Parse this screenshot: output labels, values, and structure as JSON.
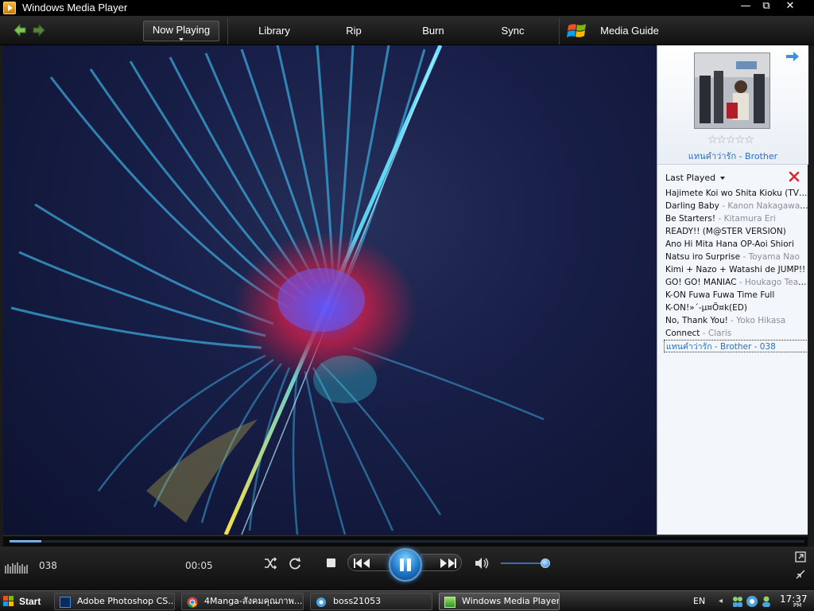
{
  "window": {
    "title": "Windows Media Player",
    "controls": {
      "minimize": "—",
      "maximize": "⧉",
      "close": "✕"
    }
  },
  "nav": {
    "tabs": [
      {
        "label": "Now Playing",
        "active": true
      },
      {
        "label": "Library"
      },
      {
        "label": "Rip"
      },
      {
        "label": "Burn"
      },
      {
        "label": "Sync"
      },
      {
        "label": "Media Guide"
      }
    ]
  },
  "now_playing": {
    "title_artist": "แทนคำว่ารัก - Brother",
    "rating_stars": "☆☆☆☆☆",
    "rating_value": 0
  },
  "playlist": {
    "header": "Last Played",
    "items": [
      {
        "title": "Hajimete Koi wo Shita Kioku (TV Edit)",
        "artist": ""
      },
      {
        "title": "Darling Baby",
        "artist": " - Kanon Nakagawa starring Nao Toyama"
      },
      {
        "title": "Be Starters!",
        "artist": " - Kitamura Eri"
      },
      {
        "title": "READY!! (M@STER VERSION)",
        "artist": ""
      },
      {
        "title": "Ano Hi Mita Hana OP-Aoi Shiori",
        "artist": ""
      },
      {
        "title": "Natsu iro Surprise",
        "artist": " - Toyama Nao"
      },
      {
        "title": "Kimi + Nazo + Watashi de JUMP!!",
        "artist": ""
      },
      {
        "title": "GO! GO! MANIAC",
        "artist": " - Houkago Tea Time"
      },
      {
        "title": "K-ON Fuwa Fuwa Time Full",
        "artist": ""
      },
      {
        "title": "K-ON!»´-µ¤Ö¤k(ED)",
        "artist": ""
      },
      {
        "title": "No, Thank You!",
        "artist": " - Yoko Hikasa"
      },
      {
        "title": "Connect",
        "artist": " - Claris"
      },
      {
        "title": "แทนคำว่ารัก - Brother - 038",
        "artist": "",
        "current": true
      }
    ]
  },
  "player": {
    "track_number": "038",
    "elapsed": "00:05",
    "seek_progress": 0.04,
    "volume": 0.9,
    "state": "playing"
  },
  "taskbar": {
    "start_label": "Start",
    "tasks": [
      {
        "label": "Adobe Photoshop CS...",
        "icon": "photoshop-icon"
      },
      {
        "label": "4Manga-สังคมคุณภาพ...",
        "icon": "chrome-icon"
      },
      {
        "label": "boss21053",
        "icon": "messenger-icon"
      },
      {
        "label": "Windows Media Player",
        "icon": "media-player-icon",
        "active": true
      }
    ],
    "language": "EN",
    "clock_time": "17:37",
    "clock_ampm": "PM"
  },
  "colors": {
    "accent_blue": "#2a6fbd",
    "viz_background": "#181f48",
    "pane_background": "#f3f6fb"
  }
}
